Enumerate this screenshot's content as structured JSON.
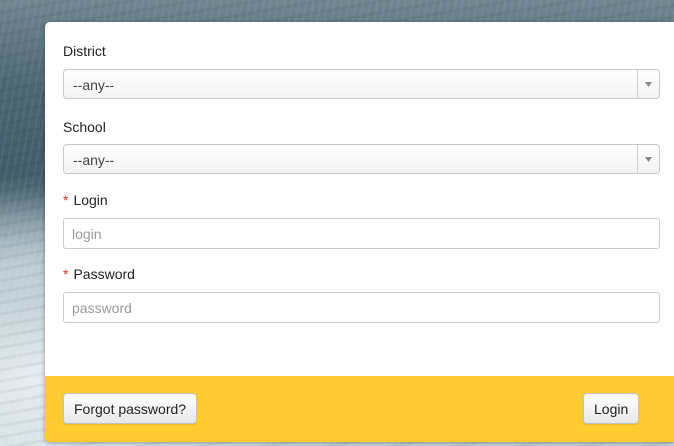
{
  "form": {
    "district": {
      "label": "District",
      "selected": "--any--",
      "arrow_icon": "chevron-down-icon"
    },
    "school": {
      "label": "School",
      "selected": "--any--",
      "arrow_icon": "chevron-down-icon"
    },
    "login": {
      "required_marker": "*",
      "label": "Login",
      "placeholder": "login",
      "value": ""
    },
    "password": {
      "required_marker": "*",
      "label": "Password",
      "placeholder": "password",
      "value": ""
    }
  },
  "footer": {
    "forgot_password_label": "Forgot password?",
    "login_button_label": "Login"
  },
  "colors": {
    "footer_background": "#ffcb31",
    "required_marker": "#e0302a",
    "panel_background": "#ffffff"
  }
}
